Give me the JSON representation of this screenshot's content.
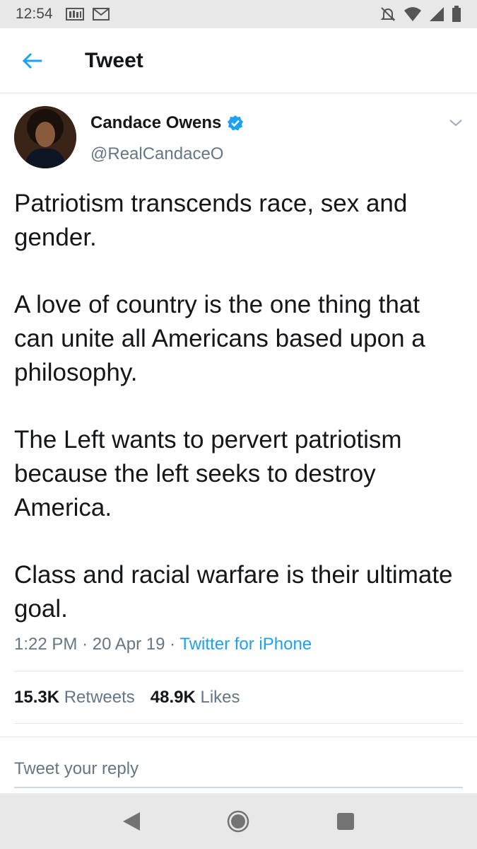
{
  "status_bar": {
    "time": "12:54"
  },
  "header": {
    "title": "Tweet"
  },
  "tweet": {
    "author_name": "Candace Owens",
    "author_handle": "@RealCandaceO",
    "paragraphs": [
      "Patriotism transcends race, sex and gender.",
      "A love of country is the one thing that can unite all Americans based upon a philosophy.",
      "The Left wants to pervert patriotism because the left seeks to destroy America.",
      "Class and racial warfare is their ultimate goal."
    ],
    "time": "1:22 PM",
    "separator": "·",
    "date": "20 Apr 19",
    "source": "Twitter for iPhone",
    "retweets_count": "15.3K",
    "retweets_label": "Retweets",
    "likes_count": "48.9K",
    "likes_label": "Likes"
  },
  "reply": {
    "placeholder": "Tweet your reply"
  },
  "colors": {
    "accent": "#1da1f2",
    "muted": "#657786",
    "text": "#14171a"
  },
  "icons": {
    "back": "arrow-left-icon",
    "verified": "verified-badge-icon",
    "menu": "chevron-down-icon",
    "nav_back": "triangle-back-icon",
    "nav_home": "circle-home-icon",
    "nav_recents": "square-recents-icon"
  }
}
